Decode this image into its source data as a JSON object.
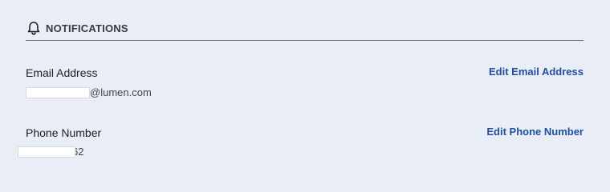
{
  "section": {
    "title": "NOTIFICATIONS",
    "icon": "bell-icon"
  },
  "email": {
    "label": "Email Address",
    "value_suffix": "@lumen.com",
    "edit_label": "Edit Email Address"
  },
  "phone": {
    "label": "Phone Number",
    "value_suffix": "62",
    "edit_label": "Edit Phone Number"
  },
  "colors": {
    "background": "#e9edf5",
    "link": "#1f4fa0",
    "divider": "#707070"
  }
}
